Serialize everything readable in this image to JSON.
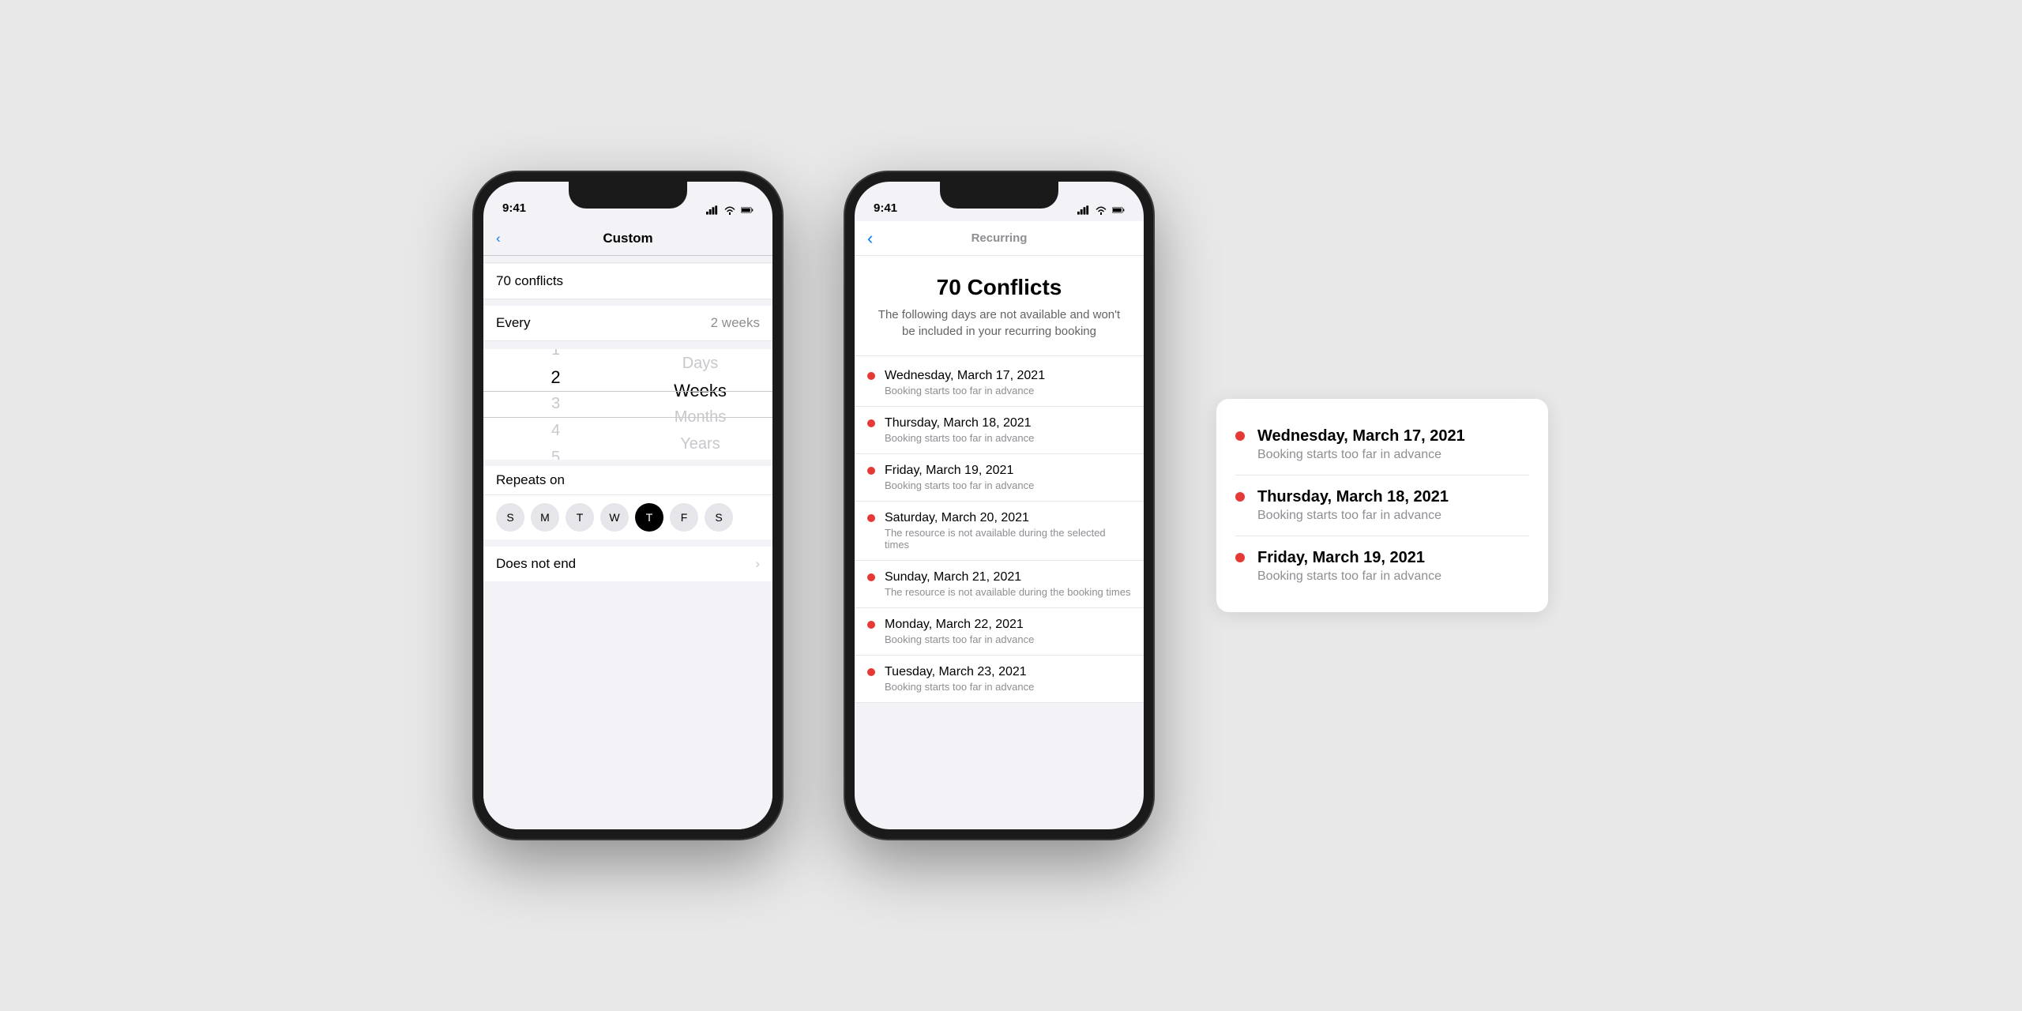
{
  "phone1": {
    "status": {
      "time": "9:41",
      "signal": "signal",
      "wifi": "wifi",
      "battery": "battery"
    },
    "nav": {
      "title": "Custom",
      "back_label": "‹"
    },
    "conflicts_label": "70 conflicts",
    "every": {
      "label": "Every",
      "value": "2 weeks"
    },
    "picker": {
      "numbers": [
        "1",
        "2",
        "3",
        "4",
        "5"
      ],
      "selected_number": "2",
      "units": [
        "Days",
        "Weeks",
        "Months",
        "Years"
      ],
      "selected_unit": "Weeks"
    },
    "repeats_on": {
      "label": "Repeats on",
      "days": [
        {
          "label": "S",
          "active": false
        },
        {
          "label": "M",
          "active": false
        },
        {
          "label": "T",
          "active": false
        },
        {
          "label": "W",
          "active": false
        },
        {
          "label": "T",
          "active": true
        },
        {
          "label": "F",
          "active": false
        },
        {
          "label": "S",
          "active": false
        }
      ]
    },
    "end": {
      "label": "Does not end"
    }
  },
  "phone2": {
    "status": {
      "time": "9:41"
    },
    "nav": {
      "title": "Recurring",
      "back_label": "‹"
    },
    "modal": {
      "title": "70 Conflicts",
      "subtitle": "The following days are not available and won't be included in your recurring booking"
    },
    "conflicts": [
      {
        "date": "Wednesday, March 17, 2021",
        "reason": "Booking starts too far in advance"
      },
      {
        "date": "Thursday, March 18, 2021",
        "reason": "Booking starts too far in advance"
      },
      {
        "date": "Friday, March 19, 2021",
        "reason": "Booking starts too far in advance"
      },
      {
        "date": "Saturday, March 20, 2021",
        "reason": "The resource is not available during the selected times"
      },
      {
        "date": "Sunday, March 21, 2021",
        "reason": "The resource is not available during the booking times"
      },
      {
        "date": "Monday, March 22, 2021",
        "reason": "Booking starts too far in advance"
      },
      {
        "date": "Tuesday, March 23, 2021",
        "reason": "Booking starts too far in advance"
      }
    ]
  },
  "card": {
    "items": [
      {
        "date": "Wednesday, March 17, 2021",
        "reason": "Booking starts too far in advance"
      },
      {
        "date": "Thursday, March 18, 2021",
        "reason": "Booking starts too far in advance"
      },
      {
        "date": "Friday, March 19, 2021",
        "reason": "Booking starts too far in advance"
      }
    ]
  }
}
